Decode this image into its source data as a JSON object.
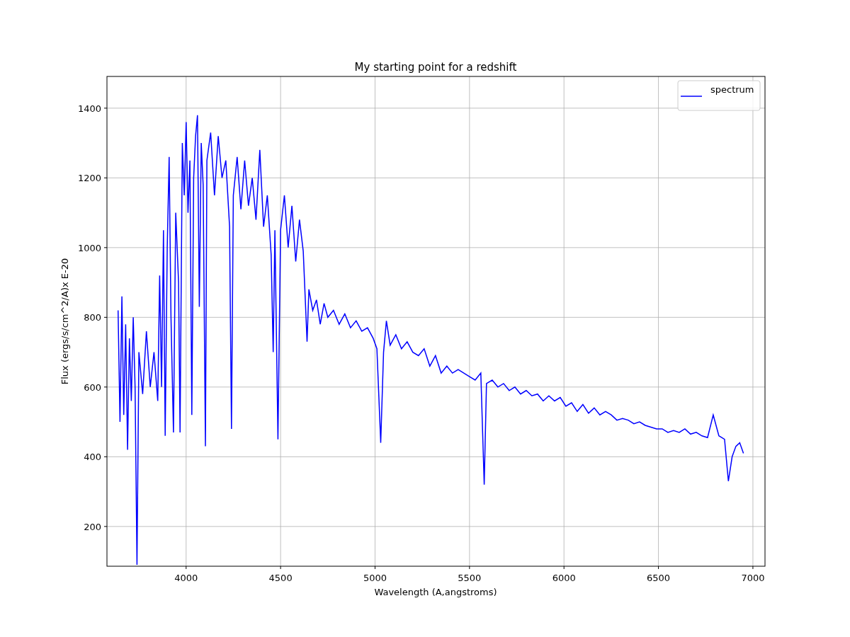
{
  "chart_data": {
    "type": "line",
    "title": "My starting point for a redshift",
    "xlabel": "Wavelength (A,angstroms)",
    "grid": true,
    "ylabel": "Flux (ergs/s/cm^2/A)x E-20",
    "xlim": [
      3581,
      7064
    ],
    "ylim": [
      86,
      1491
    ],
    "xticks": [
      4000,
      4500,
      5000,
      5500,
      6000,
      6500,
      7000
    ],
    "yticks": [
      200,
      400,
      600,
      800,
      1000,
      1200,
      1400
    ],
    "x": [
      3640,
      3650,
      3660,
      3670,
      3680,
      3690,
      3700,
      3710,
      3720,
      3730,
      3740,
      3750,
      3770,
      3790,
      3810,
      3830,
      3850,
      3860,
      3870,
      3880,
      3889,
      3900,
      3910,
      3920,
      3933,
      3945,
      3960,
      3968,
      3980,
      3990,
      4000,
      4010,
      4020,
      4030,
      4040,
      4050,
      4060,
      4070,
      4080,
      4090,
      4102,
      4110,
      4130,
      4150,
      4170,
      4190,
      4210,
      4230,
      4240,
      4250,
      4270,
      4290,
      4310,
      4330,
      4350,
      4370,
      4390,
      4410,
      4430,
      4450,
      4461,
      4470,
      4486,
      4500,
      4520,
      4540,
      4560,
      4580,
      4600,
      4620,
      4640,
      4650,
      4670,
      4690,
      4710,
      4730,
      4750,
      4780,
      4810,
      4840,
      4870,
      4900,
      4930,
      4960,
      4990,
      5010,
      5030,
      5045,
      5060,
      5080,
      5110,
      5140,
      5170,
      5200,
      5230,
      5260,
      5290,
      5320,
      5350,
      5380,
      5410,
      5440,
      5470,
      5500,
      5530,
      5560,
      5578,
      5590,
      5620,
      5650,
      5680,
      5710,
      5740,
      5770,
      5800,
      5830,
      5860,
      5890,
      5920,
      5950,
      5980,
      6010,
      6040,
      6070,
      6100,
      6130,
      6160,
      6190,
      6220,
      6250,
      6280,
      6310,
      6340,
      6370,
      6400,
      6430,
      6460,
      6490,
      6520,
      6550,
      6580,
      6610,
      6640,
      6670,
      6700,
      6730,
      6760,
      6790,
      6820,
      6850,
      6870,
      6890,
      6910,
      6930,
      6950
    ],
    "series": [
      {
        "name": "spectrum",
        "color": "#0000ff",
        "values": [
          820,
          500,
          860,
          520,
          780,
          420,
          740,
          560,
          800,
          600,
          90,
          700,
          580,
          760,
          600,
          700,
          560,
          920,
          600,
          1050,
          460,
          1000,
          1260,
          800,
          470,
          1100,
          900,
          470,
          1300,
          1150,
          1360,
          1100,
          1250,
          520,
          1200,
          1320,
          1380,
          830,
          1300,
          1180,
          430,
          1250,
          1330,
          1150,
          1320,
          1200,
          1250,
          1060,
          480,
          1150,
          1260,
          1110,
          1250,
          1120,
          1200,
          1080,
          1280,
          1060,
          1150,
          980,
          700,
          1050,
          450,
          1050,
          1150,
          1000,
          1120,
          960,
          1080,
          990,
          730,
          880,
          820,
          850,
          780,
          840,
          800,
          820,
          780,
          810,
          770,
          790,
          760,
          770,
          740,
          710,
          440,
          700,
          790,
          720,
          750,
          710,
          730,
          700,
          690,
          710,
          660,
          690,
          640,
          660,
          640,
          650,
          640,
          630,
          620,
          640,
          320,
          610,
          620,
          600,
          610,
          590,
          600,
          580,
          590,
          575,
          580,
          560,
          575,
          560,
          570,
          545,
          555,
          530,
          550,
          525,
          540,
          520,
          530,
          520,
          505,
          510,
          505,
          495,
          500,
          490,
          485,
          480,
          480,
          470,
          475,
          470,
          480,
          465,
          470,
          460,
          455,
          520,
          460,
          450,
          330,
          400,
          430,
          440,
          410
        ]
      }
    ]
  }
}
